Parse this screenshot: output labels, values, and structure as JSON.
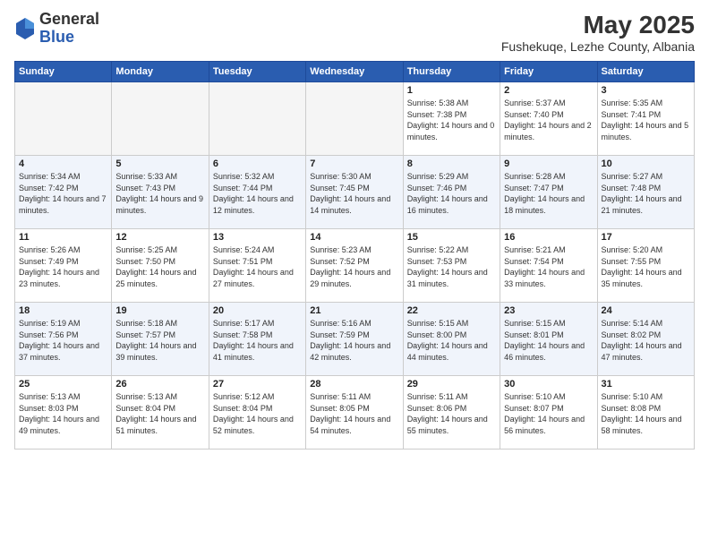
{
  "header": {
    "logo_general": "General",
    "logo_blue": "Blue",
    "month_year": "May 2025",
    "location": "Fushekuqe, Lezhe County, Albania"
  },
  "weekdays": [
    "Sunday",
    "Monday",
    "Tuesday",
    "Wednesday",
    "Thursday",
    "Friday",
    "Saturday"
  ],
  "weeks": [
    [
      {
        "day": "",
        "info": ""
      },
      {
        "day": "",
        "info": ""
      },
      {
        "day": "",
        "info": ""
      },
      {
        "day": "",
        "info": ""
      },
      {
        "day": "1",
        "info": "Sunrise: 5:38 AM\nSunset: 7:38 PM\nDaylight: 14 hours and 0 minutes."
      },
      {
        "day": "2",
        "info": "Sunrise: 5:37 AM\nSunset: 7:40 PM\nDaylight: 14 hours and 2 minutes."
      },
      {
        "day": "3",
        "info": "Sunrise: 5:35 AM\nSunset: 7:41 PM\nDaylight: 14 hours and 5 minutes."
      }
    ],
    [
      {
        "day": "4",
        "info": "Sunrise: 5:34 AM\nSunset: 7:42 PM\nDaylight: 14 hours and 7 minutes."
      },
      {
        "day": "5",
        "info": "Sunrise: 5:33 AM\nSunset: 7:43 PM\nDaylight: 14 hours and 9 minutes."
      },
      {
        "day": "6",
        "info": "Sunrise: 5:32 AM\nSunset: 7:44 PM\nDaylight: 14 hours and 12 minutes."
      },
      {
        "day": "7",
        "info": "Sunrise: 5:30 AM\nSunset: 7:45 PM\nDaylight: 14 hours and 14 minutes."
      },
      {
        "day": "8",
        "info": "Sunrise: 5:29 AM\nSunset: 7:46 PM\nDaylight: 14 hours and 16 minutes."
      },
      {
        "day": "9",
        "info": "Sunrise: 5:28 AM\nSunset: 7:47 PM\nDaylight: 14 hours and 18 minutes."
      },
      {
        "day": "10",
        "info": "Sunrise: 5:27 AM\nSunset: 7:48 PM\nDaylight: 14 hours and 21 minutes."
      }
    ],
    [
      {
        "day": "11",
        "info": "Sunrise: 5:26 AM\nSunset: 7:49 PM\nDaylight: 14 hours and 23 minutes."
      },
      {
        "day": "12",
        "info": "Sunrise: 5:25 AM\nSunset: 7:50 PM\nDaylight: 14 hours and 25 minutes."
      },
      {
        "day": "13",
        "info": "Sunrise: 5:24 AM\nSunset: 7:51 PM\nDaylight: 14 hours and 27 minutes."
      },
      {
        "day": "14",
        "info": "Sunrise: 5:23 AM\nSunset: 7:52 PM\nDaylight: 14 hours and 29 minutes."
      },
      {
        "day": "15",
        "info": "Sunrise: 5:22 AM\nSunset: 7:53 PM\nDaylight: 14 hours and 31 minutes."
      },
      {
        "day": "16",
        "info": "Sunrise: 5:21 AM\nSunset: 7:54 PM\nDaylight: 14 hours and 33 minutes."
      },
      {
        "day": "17",
        "info": "Sunrise: 5:20 AM\nSunset: 7:55 PM\nDaylight: 14 hours and 35 minutes."
      }
    ],
    [
      {
        "day": "18",
        "info": "Sunrise: 5:19 AM\nSunset: 7:56 PM\nDaylight: 14 hours and 37 minutes."
      },
      {
        "day": "19",
        "info": "Sunrise: 5:18 AM\nSunset: 7:57 PM\nDaylight: 14 hours and 39 minutes."
      },
      {
        "day": "20",
        "info": "Sunrise: 5:17 AM\nSunset: 7:58 PM\nDaylight: 14 hours and 41 minutes."
      },
      {
        "day": "21",
        "info": "Sunrise: 5:16 AM\nSunset: 7:59 PM\nDaylight: 14 hours and 42 minutes."
      },
      {
        "day": "22",
        "info": "Sunrise: 5:15 AM\nSunset: 8:00 PM\nDaylight: 14 hours and 44 minutes."
      },
      {
        "day": "23",
        "info": "Sunrise: 5:15 AM\nSunset: 8:01 PM\nDaylight: 14 hours and 46 minutes."
      },
      {
        "day": "24",
        "info": "Sunrise: 5:14 AM\nSunset: 8:02 PM\nDaylight: 14 hours and 47 minutes."
      }
    ],
    [
      {
        "day": "25",
        "info": "Sunrise: 5:13 AM\nSunset: 8:03 PM\nDaylight: 14 hours and 49 minutes."
      },
      {
        "day": "26",
        "info": "Sunrise: 5:13 AM\nSunset: 8:04 PM\nDaylight: 14 hours and 51 minutes."
      },
      {
        "day": "27",
        "info": "Sunrise: 5:12 AM\nSunset: 8:04 PM\nDaylight: 14 hours and 52 minutes."
      },
      {
        "day": "28",
        "info": "Sunrise: 5:11 AM\nSunset: 8:05 PM\nDaylight: 14 hours and 54 minutes."
      },
      {
        "day": "29",
        "info": "Sunrise: 5:11 AM\nSunset: 8:06 PM\nDaylight: 14 hours and 55 minutes."
      },
      {
        "day": "30",
        "info": "Sunrise: 5:10 AM\nSunset: 8:07 PM\nDaylight: 14 hours and 56 minutes."
      },
      {
        "day": "31",
        "info": "Sunrise: 5:10 AM\nSunset: 8:08 PM\nDaylight: 14 hours and 58 minutes."
      }
    ]
  ]
}
